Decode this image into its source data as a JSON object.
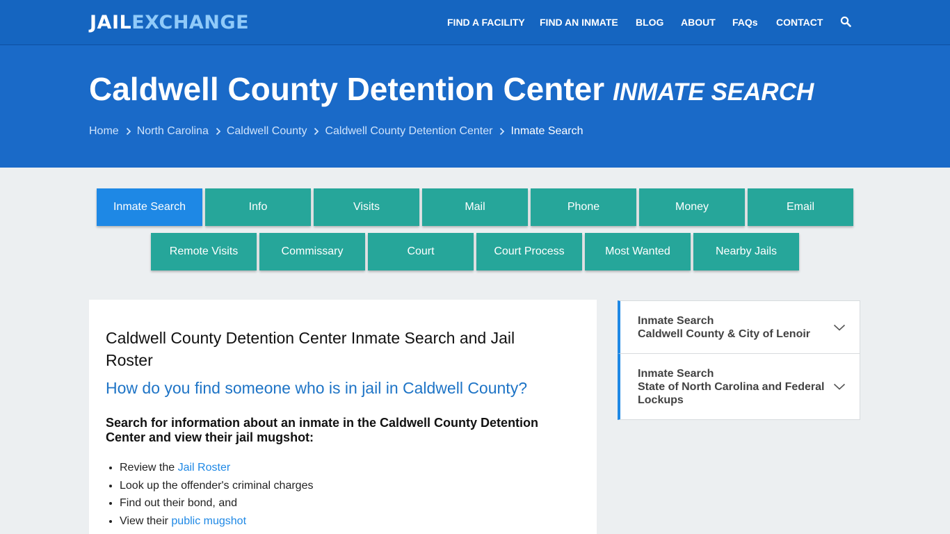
{
  "header": {
    "logo": {
      "part1": "JAIL",
      "part2": "EXCHANGE"
    },
    "nav": [
      "FIND A FACILITY",
      "FIND AN INMATE",
      "BLOG",
      "ABOUT",
      "FAQs",
      "CONTACT"
    ],
    "search_icon": "search-icon"
  },
  "hero": {
    "title": "Caldwell County Detention Center",
    "subtitle": "INMATE SEARCH",
    "breadcrumbs": [
      "Home",
      "North Carolina",
      "Caldwell County",
      "Caldwell County Detention Center",
      "Inmate Search"
    ]
  },
  "tabs": {
    "row1": [
      "Inmate Search",
      "Info",
      "Visits",
      "Mail",
      "Phone",
      "Money",
      "Email"
    ],
    "row2": [
      "Remote Visits",
      "Commissary",
      "Court",
      "Court Process",
      "Most Wanted",
      "Nearby Jails"
    ],
    "active": "Inmate Search"
  },
  "article": {
    "heading": "Caldwell County Detention Center Inmate Search and Jail Roster",
    "question": "How do you find someone who is in jail in Caldwell County?",
    "intro": "Search for information about an inmate in the Caldwell County Detention Center and view their jail mugshot:",
    "bullets": [
      {
        "text": "Review the ",
        "link": "Jail Roster"
      },
      {
        "text": "Look up the offender's criminal charges",
        "link": ""
      },
      {
        "text": "Find out their bond, and",
        "link": ""
      },
      {
        "text": "View their ",
        "link": "public mugshot"
      }
    ]
  },
  "sidebar": {
    "items": [
      {
        "line1": "Inmate Search",
        "line2": "Caldwell County & City of Lenoir"
      },
      {
        "line1": "Inmate Search",
        "line2": "State of North Carolina and Federal Lockups"
      }
    ]
  },
  "colors": {
    "topbar": "#1565c0",
    "hero": "#1a6ac8",
    "tab": "#26a69a",
    "tab_active": "#1e88e5",
    "link": "#1e88e5",
    "question": "#1e74c6"
  }
}
